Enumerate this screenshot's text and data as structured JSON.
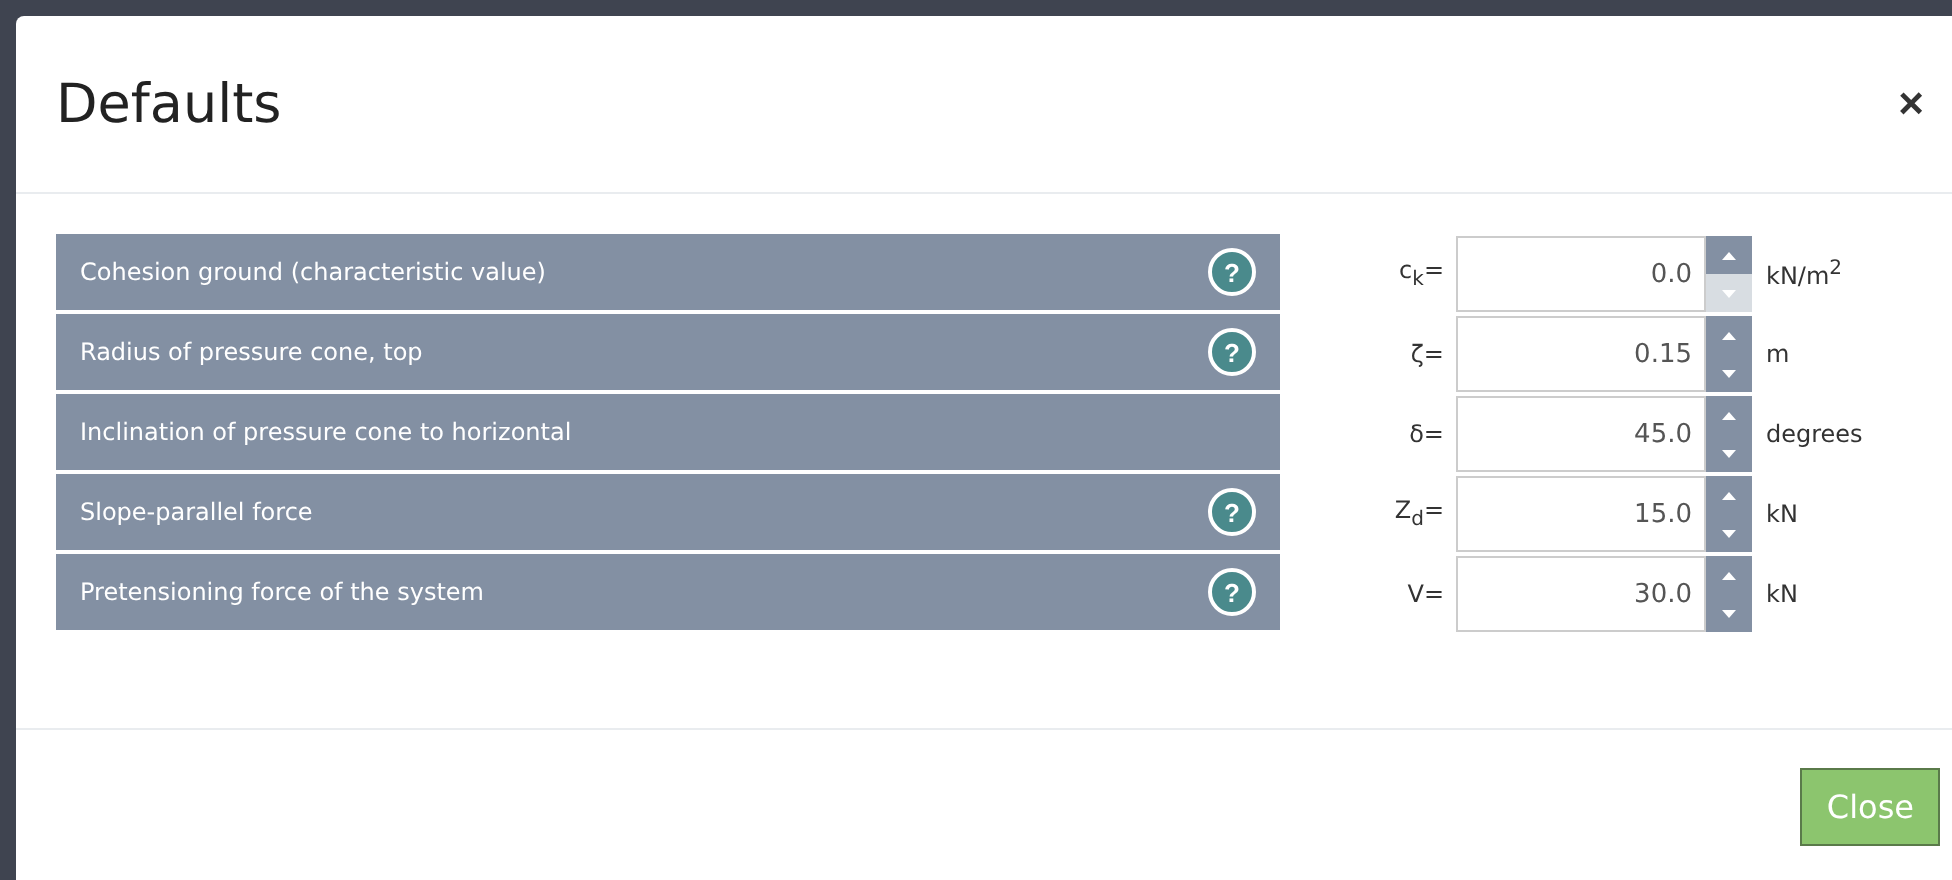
{
  "dialog": {
    "title": "Defaults",
    "close_icon": "×"
  },
  "rows": [
    {
      "label": "Cohesion ground (characteristic value)",
      "help": "?",
      "symbol": "c$_{k}$=",
      "value": "0.0",
      "unit": "kN/m$^{2}$",
      "down_disabled": true
    },
    {
      "label": "Radius of pressure cone, top",
      "help": "?",
      "symbol": "ζ=",
      "value": "0.15",
      "unit": "m",
      "down_disabled": false
    },
    {
      "label": "Inclination of pressure cone to horizontal",
      "symbol": "δ=",
      "value": "45.0",
      "unit": "degrees",
      "down_disabled": false
    },
    {
      "label": "Slope-parallel force",
      "help": "?",
      "symbol": "Z$_{d}$=",
      "value": "15.0",
      "unit": "kN",
      "down_disabled": false
    },
    {
      "label": "Pretensioning force of the system",
      "help": "?",
      "symbol": "V=",
      "value": "30.0",
      "unit": "kN",
      "down_disabled": false
    }
  ],
  "buttons": [
    "Close"
  ]
}
